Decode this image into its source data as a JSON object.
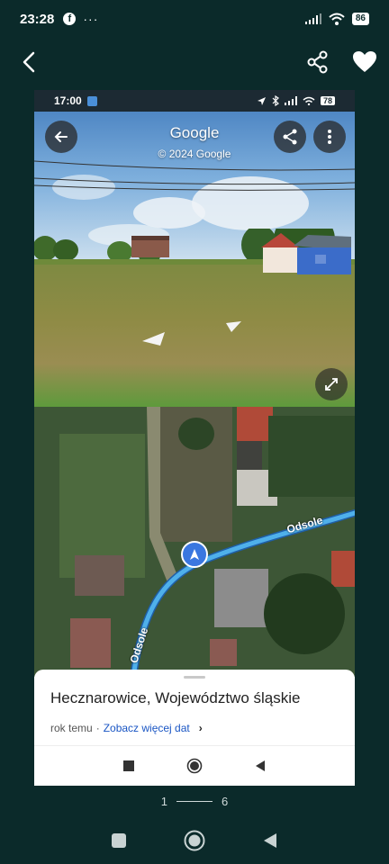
{
  "status_bar": {
    "time": "23:28",
    "facebook_glyph": "f",
    "more_dots": "···",
    "battery": "86"
  },
  "app_bar": {
    "back_icon": "back-chevron",
    "share_icon": "share",
    "favorite_icon": "heart"
  },
  "screenshot": {
    "status": {
      "time": "17:00",
      "battery": "78"
    },
    "street_view": {
      "title": "Google",
      "copyright": "© 2024 Google"
    },
    "map": {
      "street_label_1": "Odsole",
      "street_label_2": "Odsole"
    },
    "sheet": {
      "place": "Hecznarowice, Województwo śląskie",
      "date_text": "rok temu",
      "separator": " · ",
      "more_dates_link": "Zobacz więcej dat",
      "chevron": "›"
    }
  },
  "pager": {
    "current": "1",
    "total": "6"
  },
  "colors": {
    "background": "#0b2a2a",
    "link": "#1a56c4",
    "route": "#4fb0ea",
    "location_pin": "#3a77e0"
  }
}
